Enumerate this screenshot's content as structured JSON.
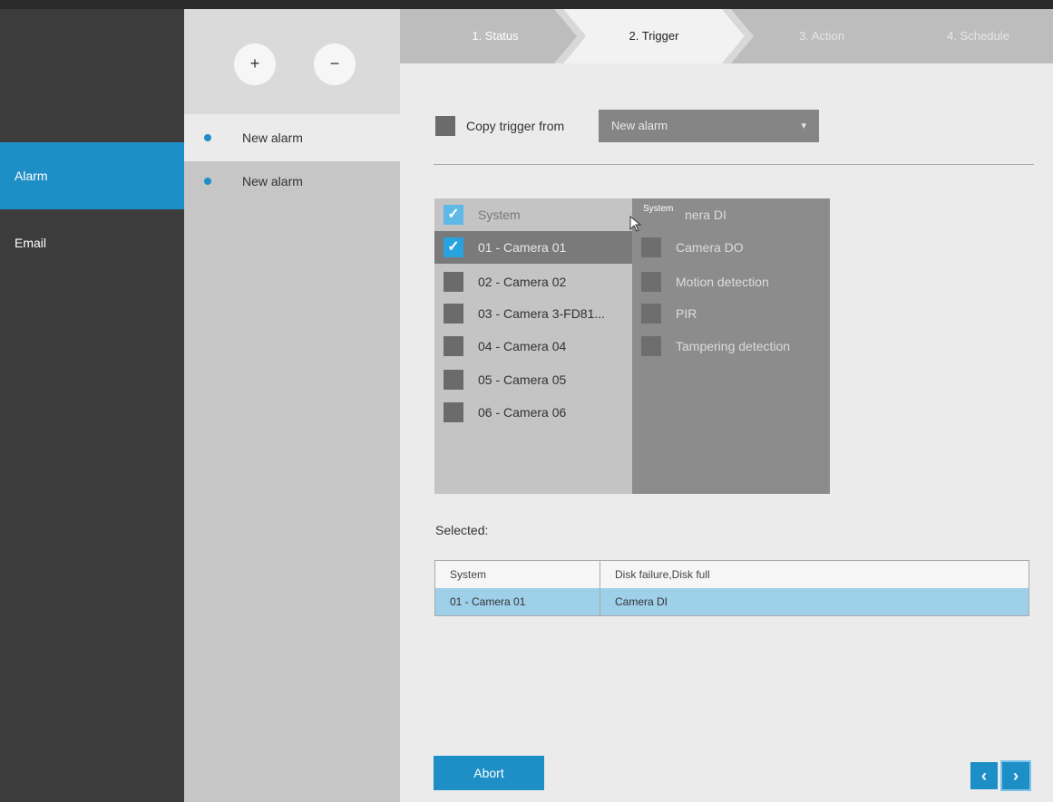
{
  "nav": {
    "items": [
      {
        "label": "Alarm"
      },
      {
        "label": "Email"
      }
    ]
  },
  "alarm_list": {
    "add_label": "+",
    "remove_label": "−",
    "items": [
      {
        "label": "New alarm"
      },
      {
        "label": "New alarm"
      }
    ]
  },
  "wizard": {
    "steps": [
      {
        "label": "1. Status"
      },
      {
        "label": "2. Trigger"
      },
      {
        "label": "3. Action"
      },
      {
        "label": "4. Schedule"
      }
    ]
  },
  "copy_trigger": {
    "label": "Copy trigger from",
    "selected": "New alarm",
    "caret": "▾"
  },
  "sources": {
    "header": "System",
    "items": [
      {
        "label": "01 - Camera 01"
      },
      {
        "label": "02 - Camera 02"
      },
      {
        "label": "03 - Camera 3-FD81..."
      },
      {
        "label": "04 - Camera 04"
      },
      {
        "label": "05 - Camera 05"
      },
      {
        "label": "06 - Camera 06"
      }
    ]
  },
  "events": {
    "tooltip": "System",
    "header": "nera DI",
    "items": [
      {
        "label": "Camera DO"
      },
      {
        "label": "Motion detection"
      },
      {
        "label": "PIR"
      },
      {
        "label": "Tampering detection"
      }
    ]
  },
  "selected": {
    "label": "Selected:",
    "rows": [
      {
        "source": "System",
        "events": "Disk failure,Disk full"
      },
      {
        "source": "01 - Camera 01",
        "events": "Camera DI"
      }
    ]
  },
  "footer": {
    "abort_label": "Abort",
    "prev_label": "‹",
    "next_label": "›"
  },
  "check_mark": "✓",
  "colors": {
    "accent": "#1e8fc6",
    "nav_bg": "#3c3c3c",
    "selected_row": "#9fd0ea"
  }
}
